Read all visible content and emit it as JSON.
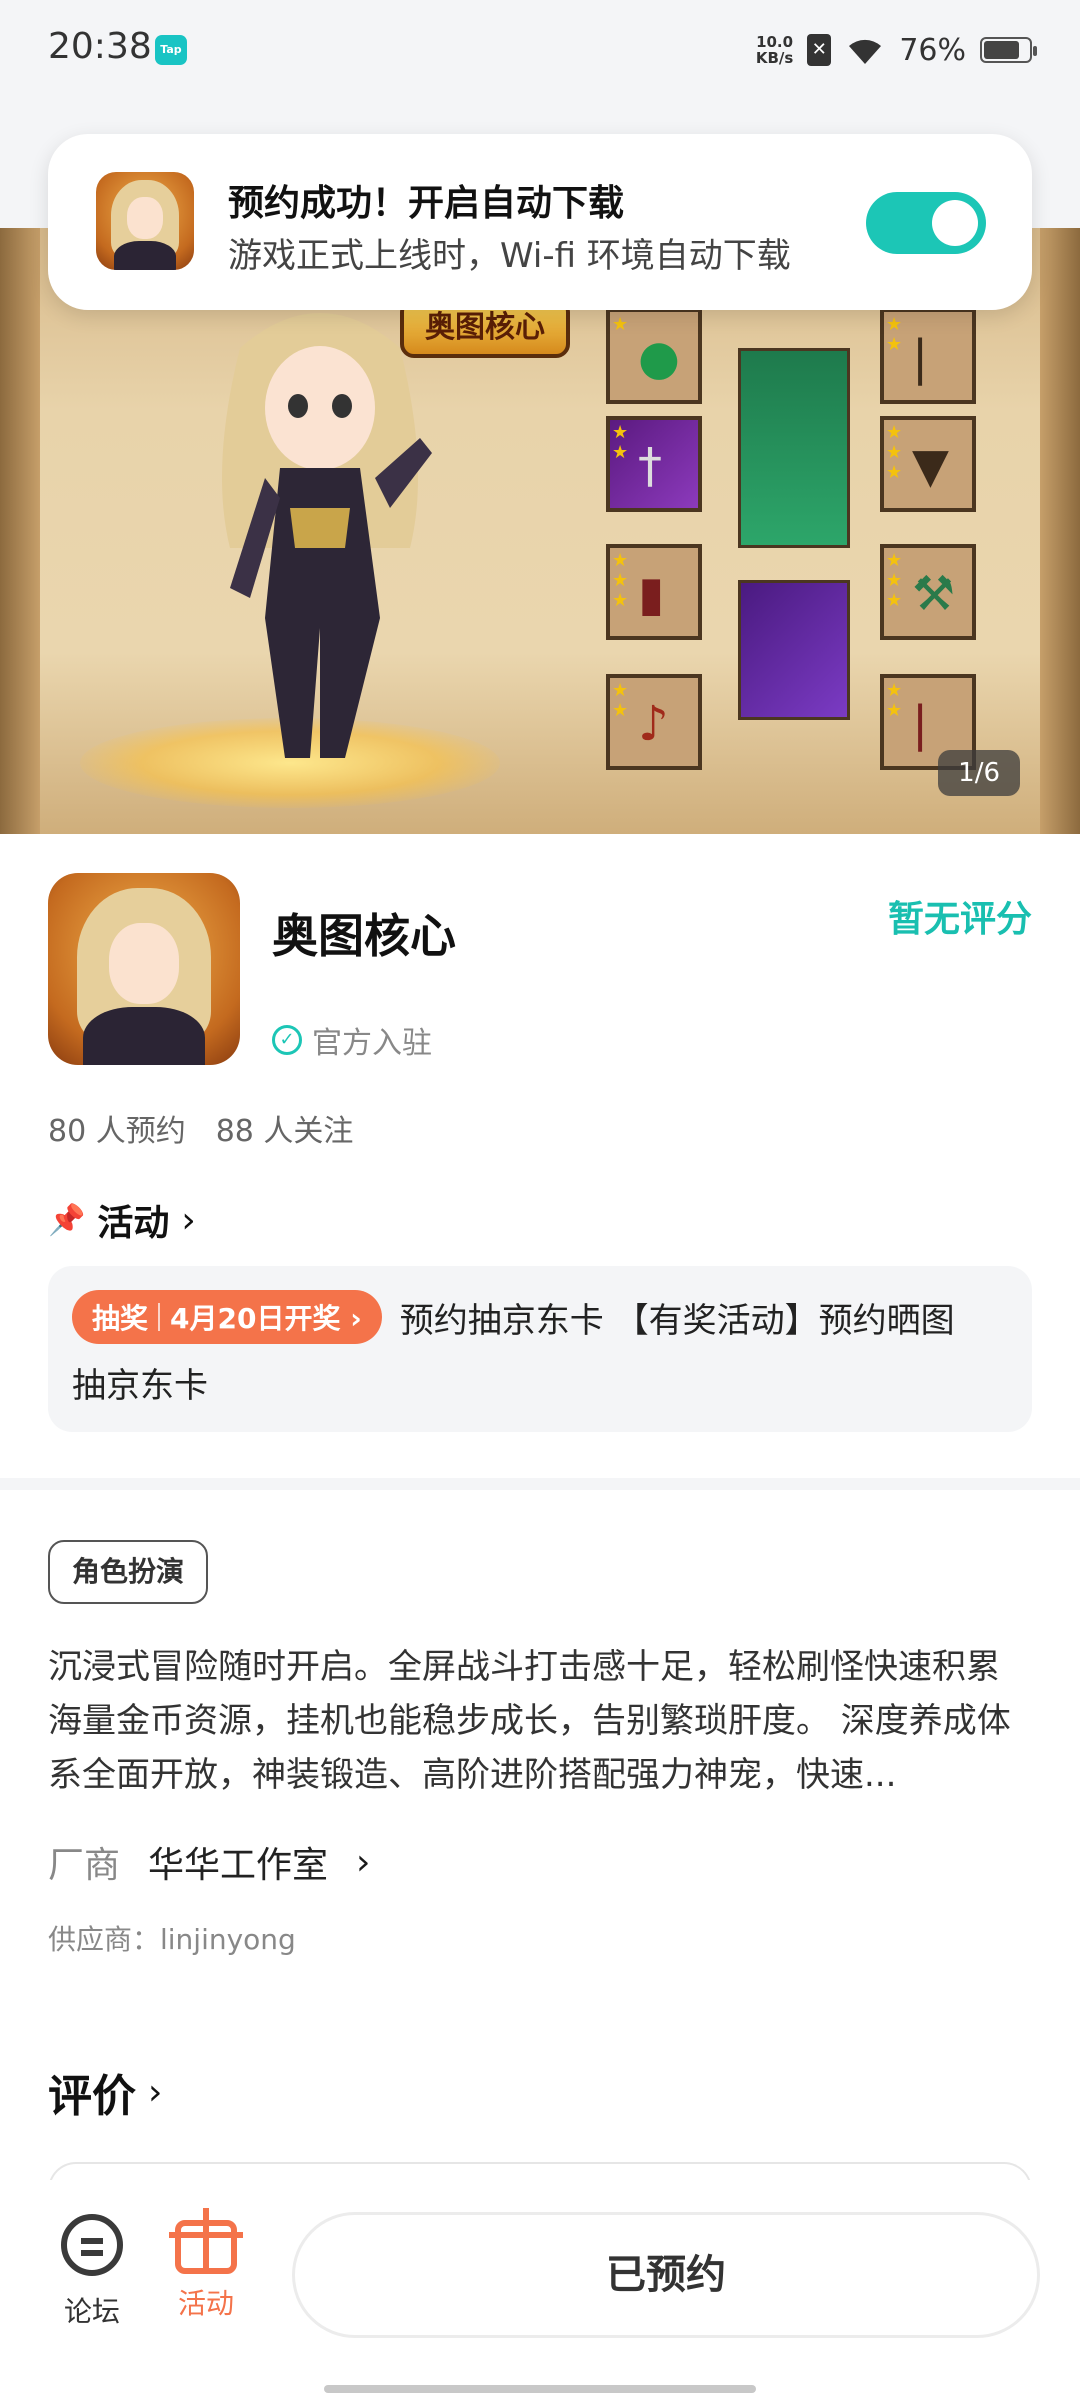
{
  "status": {
    "time": "20:38",
    "app_badge": "Tap",
    "net_speed_top": "10.0",
    "net_speed_bottom": "KB/s",
    "battery": "76%",
    "battery_level": 0.76
  },
  "notification": {
    "title": "预约成功！开启自动下载",
    "subtitle": "游戏正式上线时，Wi-fi 环境自动下载",
    "toggle_on": true
  },
  "banner": {
    "title_art": "奥图核心",
    "counter": "1/6"
  },
  "app": {
    "name": "奥图核心",
    "official_label": "官方入驻",
    "rating": "暂无评分",
    "reservations": "80 人预约",
    "followers": "88 人关注"
  },
  "activity": {
    "header": "活动",
    "badge_left": "抽奖",
    "badge_right": "4月20日开奖 ›",
    "line1": "预约抽京东卡 【有奖活动】预约晒图",
    "line2": "抽京东卡"
  },
  "details": {
    "tag": "角色扮演",
    "description": "沉浸式冒险随时开启。全屏战斗打击感十足，轻松刷怪快速积累海量金币资源，挂机也能稳步成长，告别繁琐肝度。 深度养成体系全面开放，神装锻造、高阶进阶搭配强力神宠，快速...",
    "vendor_label": "厂商",
    "vendor_name": "华华工作室",
    "supplier": "供应商：linjinyong"
  },
  "reviews": {
    "header": "评价"
  },
  "bottom_nav": {
    "forum": "论坛",
    "activity": "活动",
    "reserved_button": "已预约"
  }
}
